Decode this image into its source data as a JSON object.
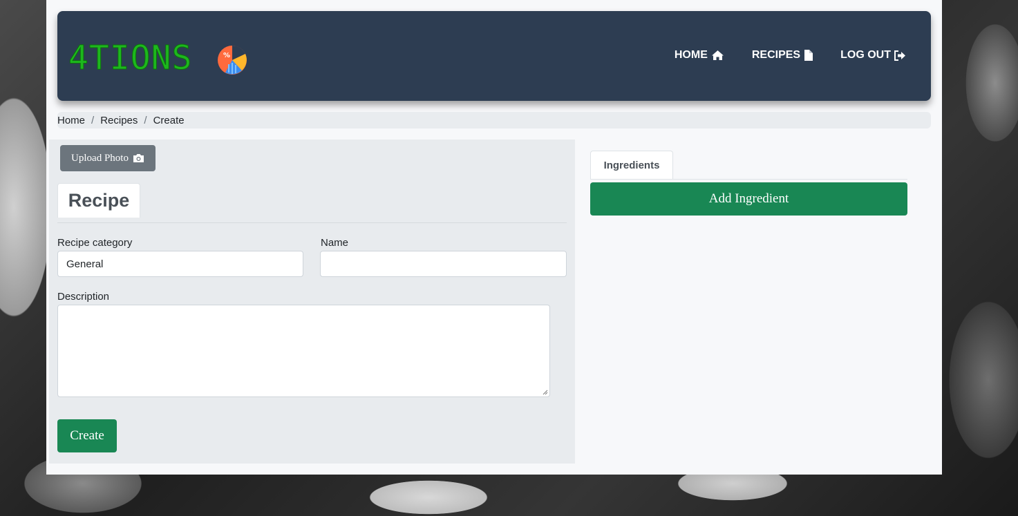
{
  "brand": {
    "name": "4TIONS",
    "logo_icon": "pie-chart-logo-icon"
  },
  "nav": {
    "items": [
      {
        "label": "HOME",
        "icon": "home-icon"
      },
      {
        "label": "RECIPES",
        "icon": "file-icon"
      },
      {
        "label": "LOG OUT",
        "icon": "sign-out-icon"
      }
    ]
  },
  "breadcrumb": [
    "Home",
    "Recipes",
    "Create"
  ],
  "recipe_form": {
    "upload_label": "Upload Photo",
    "upload_icon": "camera-icon",
    "tab_label": "Recipe",
    "category_label": "Recipe category",
    "category_value": "General",
    "name_label": "Name",
    "name_value": "",
    "description_label": "Description",
    "description_value": "",
    "submit_label": "Create"
  },
  "ingredients_panel": {
    "tab_label": "Ingredients",
    "add_label": "Add Ingredient"
  },
  "colors": {
    "navbar": "#2d3d52",
    "brand_text": "#1db81d",
    "success": "#198754",
    "secondary": "#6c757d"
  }
}
